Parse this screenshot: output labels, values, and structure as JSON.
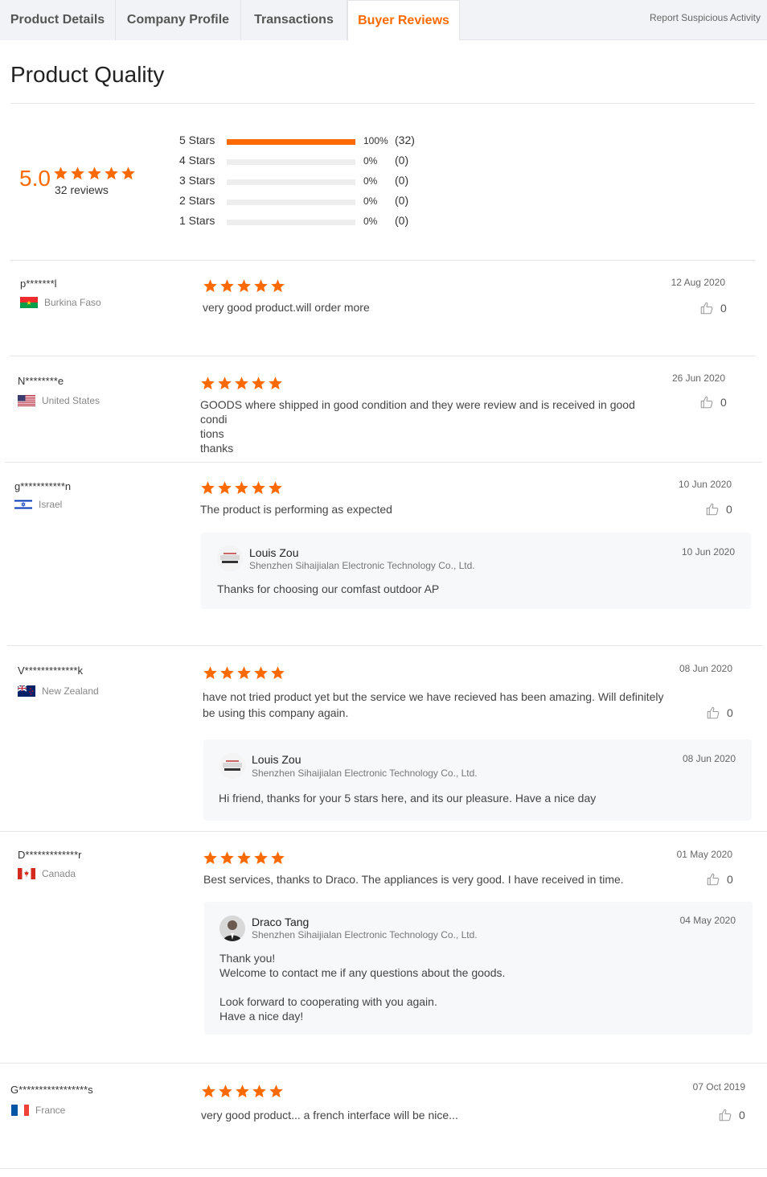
{
  "tabs": [
    {
      "label": "Product Details"
    },
    {
      "label": "Company Profile"
    },
    {
      "label": "Transactions"
    },
    {
      "label": "Buyer Reviews"
    }
  ],
  "report_link": "Report Suspicious Activity",
  "page_title": "Product Quality",
  "summary": {
    "score": "5.0",
    "reviews_label": "32 reviews",
    "distribution": [
      {
        "label": "5  Stars",
        "pct": "100%",
        "count": "(32)",
        "fraction": 1.0
      },
      {
        "label": "4  Stars",
        "pct": "0%",
        "count": "(0)",
        "fraction": 0
      },
      {
        "label": "3  Stars",
        "pct": "0%",
        "count": "(0)",
        "fraction": 0
      },
      {
        "label": "2  Stars",
        "pct": "0%",
        "count": "(0)",
        "fraction": 0
      },
      {
        "label": "1  Stars",
        "pct": "0%",
        "count": "(0)",
        "fraction": 0
      }
    ]
  },
  "colors": {
    "accent": "#ff6a00"
  },
  "reviews": [
    {
      "name": "p*******l",
      "country": "Burkina Faso",
      "flag": "burkina-faso",
      "rating": 5,
      "text_lines": [
        "very good product.will order more"
      ],
      "date": "12 Aug 2020",
      "likes": "0"
    },
    {
      "name": "N********e",
      "country": "United States",
      "flag": "united-states",
      "rating": 5,
      "text_lines": [
        "GOODS where shipped in good condition and they were review and is received in good condi",
        "tions",
        "thanks"
      ],
      "date": "26 Jun 2020",
      "likes": "0"
    },
    {
      "name": "g***********n",
      "country": "Israel",
      "flag": "israel",
      "rating": 5,
      "text_lines": [
        "The product is performing as expected"
      ],
      "date": "10 Jun 2020",
      "likes": "0",
      "reply": {
        "name": "Louis Zou",
        "company": "Shenzhen Sihaijialan Electronic Technology Co., Ltd.",
        "date": "10 Jun 2020",
        "text_lines": [
          "Thanks for choosing our comfast outdoor AP"
        ]
      }
    },
    {
      "name": "V*************k",
      "country": "New Zealand",
      "flag": "new-zealand",
      "rating": 5,
      "text_lines": [
        "have not tried product yet but the service we have recieved has been amazing. Will definitely",
        "be using this company again."
      ],
      "date": "08 Jun 2020",
      "likes": "0",
      "reply": {
        "name": "Louis Zou",
        "company": "Shenzhen Sihaijialan Electronic Technology Co., Ltd.",
        "date": "08 Jun 2020",
        "text_lines": [
          "Hi friend, thanks for your 5 stars here, and its our pleasure. Have a nice day"
        ]
      }
    },
    {
      "name": "D*************r",
      "country": "Canada",
      "flag": "canada",
      "rating": 5,
      "text_lines": [
        "Best services, thanks to Draco. The appliances is very good. I have received in time."
      ],
      "date": "01 May 2020",
      "likes": "0",
      "reply": {
        "name": "Draco Tang",
        "company": "Shenzhen Sihaijialan Electronic Technology Co., Ltd.",
        "date": "04 May 2020",
        "text_lines": [
          "Thank you!",
          "Welcome to contact me if any questions about the goods.",
          "",
          "Look forward to cooperating with you again.",
          "Have a nice day!"
        ]
      }
    },
    {
      "name": "G*****************s",
      "country": "France",
      "flag": "france",
      "rating": 5,
      "text_lines": [
        "very good product... a french interface will be nice..."
      ],
      "date": "07 Oct 2019",
      "likes": "0"
    }
  ]
}
